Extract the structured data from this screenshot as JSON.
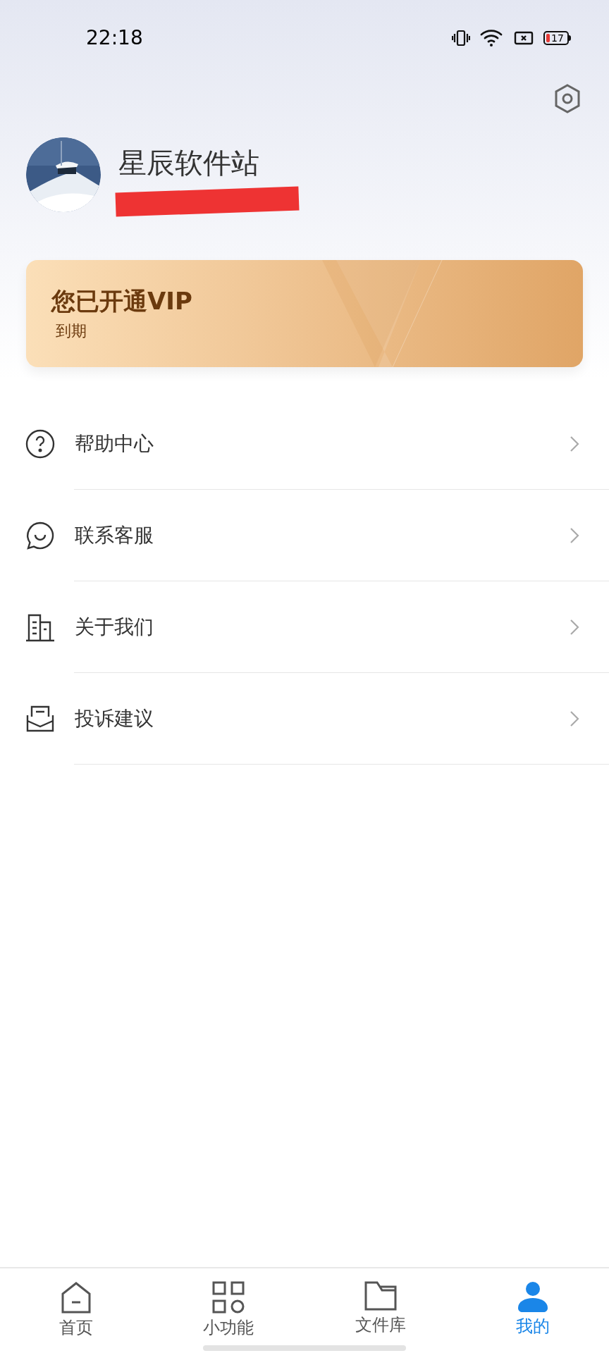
{
  "status_bar": {
    "time": "22:18",
    "battery": "17"
  },
  "profile": {
    "name": "星辰软件站"
  },
  "vip_card": {
    "title": "您已开通VIP",
    "subtitle": "到期"
  },
  "menu": [
    {
      "kind": "help",
      "label": "帮助中心"
    },
    {
      "kind": "chat",
      "label": "联系客服"
    },
    {
      "kind": "building",
      "label": "关于我们"
    },
    {
      "kind": "mail",
      "label": "投诉建议"
    }
  ],
  "nav": [
    {
      "kind": "home",
      "label": "首页",
      "selected": false
    },
    {
      "kind": "grid",
      "label": "小功能",
      "selected": false
    },
    {
      "kind": "folder",
      "label": "文件库",
      "selected": false
    },
    {
      "kind": "person",
      "label": "我的",
      "selected": true
    }
  ]
}
